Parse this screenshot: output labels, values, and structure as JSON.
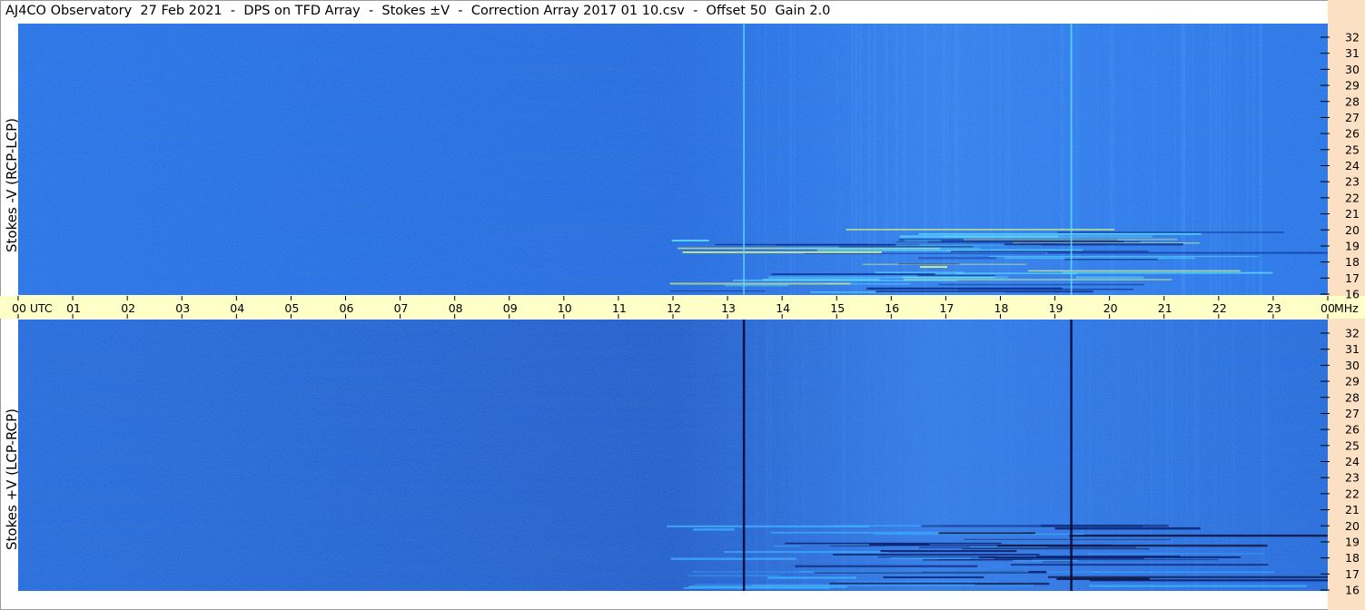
{
  "title": "AJ4CO Observatory  27 Feb 2021  -  DPS on TFD Array  -  Stokes ±V  -  Correction Array 2017 01 10.csv  -  Offset 50  Gain 2.0",
  "chart_data": {
    "type": "heatmap",
    "title": "AJ4CO Observatory  27 Feb 2021  -  DPS on TFD Array  -  Stokes ±V  -  Correction Array 2017 01 10.csv  -  Offset 50  Gain 2.0",
    "x_tick_labels": [
      "00 UTC",
      "01",
      "02",
      "03",
      "04",
      "05",
      "06",
      "07",
      "08",
      "09",
      "10",
      "11",
      "12",
      "13",
      "14",
      "15",
      "16",
      "17",
      "18",
      "19",
      "20",
      "21",
      "22",
      "23",
      "00"
    ],
    "x_range_hours": [
      0,
      24
    ],
    "frequency_unit": "MHz",
    "y_range_mhz": [
      16,
      32
    ],
    "y_tick_labels": [
      "32",
      "31",
      "30",
      "29",
      "28",
      "27",
      "26",
      "25",
      "24",
      "23",
      "22",
      "21",
      "20",
      "19",
      "18",
      "17",
      "16"
    ],
    "panels": [
      {
        "name": "top",
        "label": "Stokes -V (RCP-LCP)",
        "base_color": "#1e6ee6",
        "interference_lines_utc": [
          13.3,
          19.3
        ],
        "interference_line_color": "#5fd8ff"
      },
      {
        "name": "bottom",
        "label": "Stokes +V (LCP-RCP)",
        "base_color": "#1a62d6",
        "interference_lines_utc": [
          13.3,
          19.3
        ],
        "interference_line_color": "#0a0f3c"
      }
    ],
    "colors": {
      "axis_bar_bg": "#ffffc8",
      "right_strip_bg": "#fbe0c4",
      "tick_color": "#000000"
    }
  }
}
